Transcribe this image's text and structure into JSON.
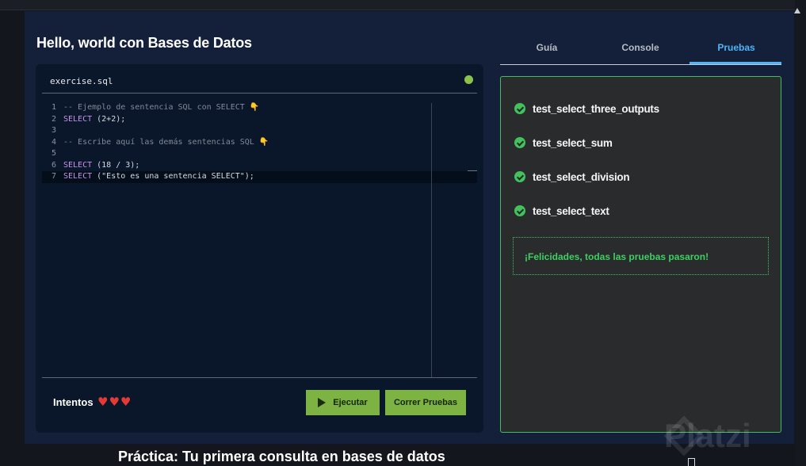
{
  "page": {
    "title": "Hello, world con Bases de Datos",
    "bottom_title": "Práctica: Tu primera consulta en bases de datos",
    "watermark": "Platzi"
  },
  "editor": {
    "file_name": "exercise.sql",
    "lines": [
      {
        "num": "1",
        "parts": [
          {
            "t": "-- Ejemplo de sentencia SQL con SELECT ",
            "c": "comment"
          },
          {
            "t": "👇",
            "c": "emoji"
          }
        ]
      },
      {
        "num": "2",
        "parts": [
          {
            "t": "SELECT",
            "c": "kw"
          },
          {
            "t": " (2+2);",
            "c": "plain"
          }
        ]
      },
      {
        "num": "3",
        "parts": []
      },
      {
        "num": "4",
        "parts": [
          {
            "t": "-- Escribe aquí las demás sentencias SQL ",
            "c": "comment"
          },
          {
            "t": "👇",
            "c": "emoji"
          }
        ]
      },
      {
        "num": "5",
        "parts": []
      },
      {
        "num": "6",
        "parts": [
          {
            "t": "SELECT",
            "c": "kw"
          },
          {
            "t": " (18 / 3);",
            "c": "plain"
          }
        ]
      },
      {
        "num": "7",
        "parts": [
          {
            "t": "SELECT",
            "c": "kw"
          },
          {
            "t": " (\"Esto es una sentencia SELECT\");",
            "c": "plain"
          }
        ],
        "active": true
      }
    ],
    "attempts_label": "Intentos",
    "hearts": [
      "♥",
      "♥",
      "♥"
    ],
    "run_label": "Ejecutar",
    "tests_label": "Correr Pruebas"
  },
  "tabs": [
    {
      "label": "Guía"
    },
    {
      "label": "Console"
    },
    {
      "label": "Pruebas",
      "active": true
    }
  ],
  "tests": {
    "items": [
      {
        "name": "test_select_three_outputs",
        "status": "passed"
      },
      {
        "name": "test_select_sum",
        "status": "passed"
      },
      {
        "name": "test_select_division",
        "status": "passed"
      },
      {
        "name": "test_select_text",
        "status": "passed"
      }
    ],
    "success_message": "¡Felicidades, todas las pruebas pasaron!"
  },
  "colors": {
    "accent_green": "#7cb342",
    "pass_green": "#43c15f",
    "tab_active": "#4fb3f6",
    "panel_bg": "#14203a"
  }
}
